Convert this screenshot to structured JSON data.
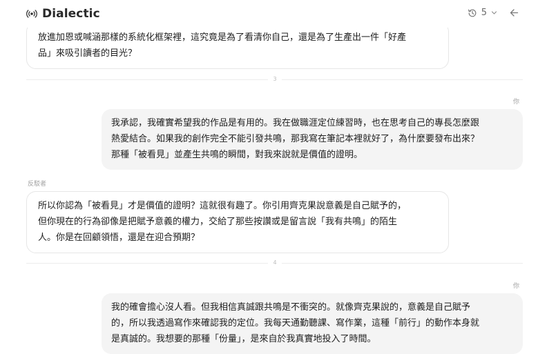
{
  "app": {
    "name": "Dialectic"
  },
  "header": {
    "history_count": "5"
  },
  "labels": {
    "you": "你",
    "opponent": "反駁者"
  },
  "turns": {
    "t3": "3",
    "t4": "4"
  },
  "messages": [
    {
      "role": "ai",
      "lines": [
        "放進加恩或喊涵那樣的系統化框架裡，這究竟是為了看清你自己，還是為了生產出一件「好產",
        "品」來吸引讀者的目光？"
      ]
    },
    {
      "role": "user",
      "lines": [
        "我承認，我確實希望我的作品是有用的。我在做職涯定位練習時，也在思考自己的專長怎麼跟",
        "熱愛結合。如果我的創作完全不能引發共鳴，那我寫在筆記本裡就好了，為什麼要發布出來？",
        "那種「被看見」並產生共鳴的瞬間，對我來說就是價值的證明。"
      ]
    },
    {
      "role": "ai",
      "lines": [
        "所以你認為「被看見」才是價值的證明？這就很有趣了。你引用齊克果說意義是自己賦予的，",
        "但你現在的行為卻像是把賦予意義的權力，交給了那些按讚或是留言說「我有共鳴」的陌生",
        "人。你是在回顧領悟，還是在迎合預期？"
      ]
    },
    {
      "role": "user",
      "lines": [
        "我的確會擔心沒人看。但我相信真誠跟共鳴是不衝突的。就像齊克果說的，意義是自己賦予",
        "的，所以我透過寫作來確認我的定位。我每天通勤聽課、寫作業，這種「前行」的動作本身就",
        "是真誠的。我想要的那種「份量」，是來自於我真實地投入了時間。"
      ]
    }
  ]
}
